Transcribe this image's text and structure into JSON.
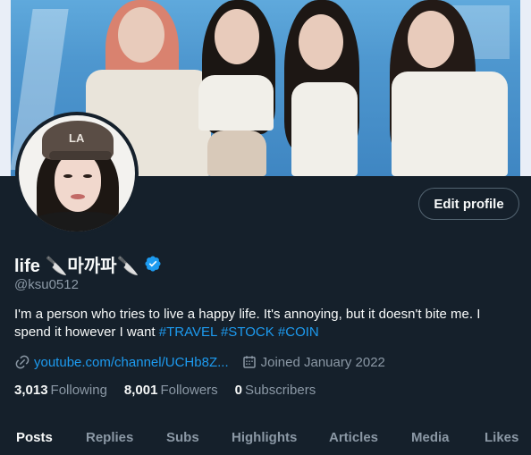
{
  "profile": {
    "display_name": "life 🔪마까파🔪",
    "handle": "@ksu0512",
    "bio_text": "I'm a person who tries to live a happy life. It's annoying, but it doesn't bite me. I spend it however I want ",
    "hashtags": [
      "#TRAVEL",
      "#STOCK",
      "#COIN"
    ],
    "link": "youtube.com/channel/UCHb8Z...",
    "joined": "Joined January 2022",
    "verified_icon": "verified-badge-icon",
    "avatar_cap_logo": "LA"
  },
  "actions": {
    "edit_profile_label": "Edit profile"
  },
  "stats": {
    "following_count": "3,013",
    "following_label": "Following",
    "followers_count": "8,001",
    "followers_label": "Followers",
    "subscribers_count": "0",
    "subscribers_label": "Subscribers"
  },
  "tabs": [
    {
      "label": "Posts",
      "active": true
    },
    {
      "label": "Replies",
      "active": false
    },
    {
      "label": "Subs",
      "active": false
    },
    {
      "label": "Highlights",
      "active": false
    },
    {
      "label": "Articles",
      "active": false
    },
    {
      "label": "Media",
      "active": false
    },
    {
      "label": "Likes",
      "active": false
    }
  ],
  "colors": {
    "background": "#15202b",
    "accent": "#1d9bf0",
    "secondary_text": "#8b98a5",
    "primary_text": "#f7f9f9"
  }
}
